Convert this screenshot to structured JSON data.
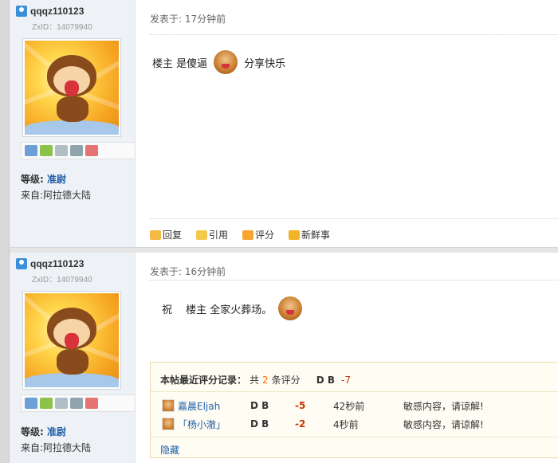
{
  "posts": [
    {
      "username": "qqqz110123",
      "zxid_label": "ZxID：",
      "zxid": "14079940",
      "level_label": "等级:",
      "level_rank": "准尉",
      "from": "来自:阿拉德大陆",
      "posted": "发表于: 17分钟前",
      "content_before": "楼主 是傻逼",
      "content_after": "分享快乐",
      "actions": [
        "回复",
        "引用",
        "评分",
        "新鲜事"
      ]
    },
    {
      "username": "qqqz110123",
      "zxid_label": "ZxID：",
      "zxid": "14079940",
      "level_label": "等级:",
      "level_rank": "准尉",
      "from": "来自:阿拉德大陆",
      "posted": "发表于: 16分钟前",
      "content_before": "祝　 楼主 全家火葬场。",
      "rating": {
        "title": "本帖最近评分记录：",
        "count_prefix": "共",
        "count": "2",
        "count_suffix": "条评分",
        "sum_label": "D B",
        "sum_value": "-7",
        "rows": [
          {
            "user": "嘉晨Eljah",
            "field": "D B",
            "score": "-5",
            "when": "42秒前",
            "reason": "敏感内容，请谅解!"
          },
          {
            "user": "「杨小澈」",
            "field": "D B",
            "score": "-2",
            "when": "4秒前",
            "reason": "敏感内容，请谅解!"
          }
        ],
        "hide_label": "隐藏"
      }
    }
  ],
  "icons": {
    "user": "user-badge-icon",
    "emoji": "monkey-emoji-icon",
    "reply": "reply-icon",
    "quote": "quote-icon",
    "rate": "rate-icon",
    "new": "news-icon"
  }
}
